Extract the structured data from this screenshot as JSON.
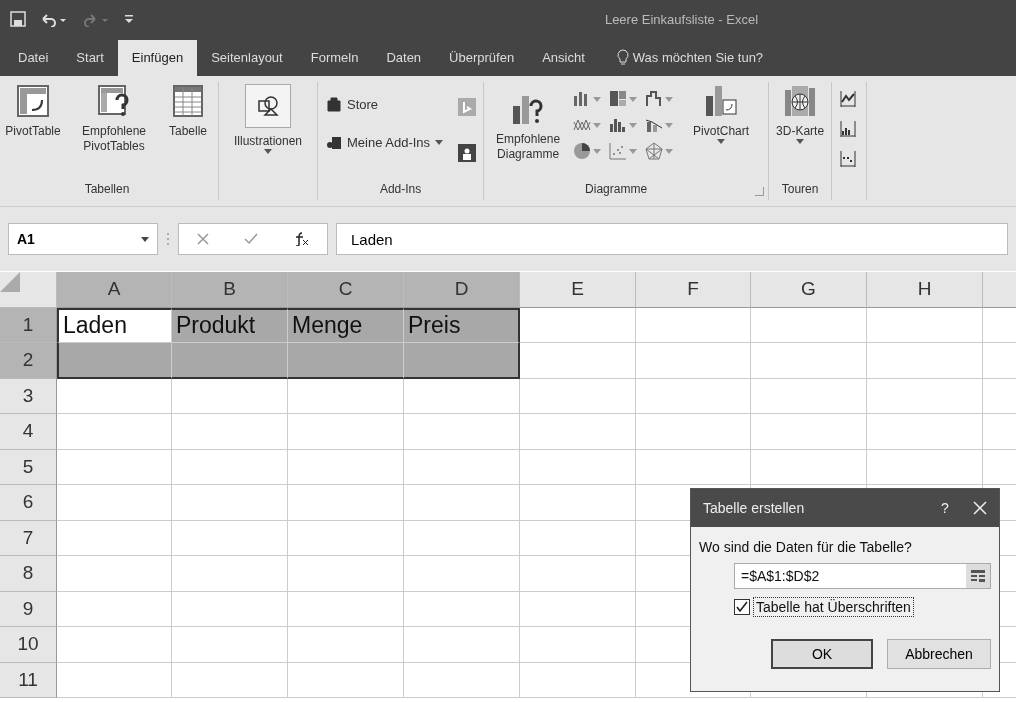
{
  "window": {
    "title": "Leere Einkaufsliste - Excel"
  },
  "tabs": [
    {
      "label": "Datei",
      "selected": false
    },
    {
      "label": "Start",
      "selected": false
    },
    {
      "label": "Einfügen",
      "selected": true
    },
    {
      "label": "Seitenlayout",
      "selected": false
    },
    {
      "label": "Formeln",
      "selected": false
    },
    {
      "label": "Daten",
      "selected": false
    },
    {
      "label": "Überprüfen",
      "selected": false
    },
    {
      "label": "Ansicht",
      "selected": false
    }
  ],
  "tell_me": {
    "placeholder": "Was möchten Sie tun?"
  },
  "ribbon": {
    "groups": [
      {
        "label": "Tabellen",
        "items": [
          {
            "kind": "pivot",
            "label": "PivotTable"
          },
          {
            "kind": "recpivot",
            "label": "Empfohlene PivotTables"
          },
          {
            "kind": "table",
            "label": "Tabelle"
          }
        ]
      },
      {
        "items": [
          {
            "kind": "shapes",
            "label": "Illustrationen",
            "dropdown": true
          }
        ]
      },
      {
        "label": "Add-Ins",
        "items": [
          {
            "kind": "addins"
          }
        ]
      },
      {
        "label": "Diagramme",
        "items": [
          {
            "kind": "recchart",
            "label": "Empfohlene Diagramme"
          },
          {
            "kind": "chartgrid"
          },
          {
            "kind": "pivotchart",
            "label": "PivotChart",
            "dropdown": true
          }
        ],
        "launcher": true
      },
      {
        "label": "Touren",
        "items": [
          {
            "kind": "map",
            "label": "3D-Karte",
            "dropdown": true
          }
        ]
      },
      {
        "items": [
          {
            "kind": "sparklines"
          }
        ]
      }
    ]
  },
  "addins": [
    {
      "label": "Store"
    },
    {
      "label": "Meine Add-Ins",
      "dropdown": true
    }
  ],
  "formula_bar": {
    "name_box": "A1",
    "formula": "Laden"
  },
  "sheet": {
    "columns": [
      {
        "label": "A",
        "selected": true
      },
      {
        "label": "B",
        "selected": true
      },
      {
        "label": "C",
        "selected": true
      },
      {
        "label": "D",
        "selected": true
      },
      {
        "label": "E",
        "selected": false
      },
      {
        "label": "F",
        "selected": false
      },
      {
        "label": "G",
        "selected": false
      },
      {
        "label": "H",
        "selected": false
      }
    ],
    "rows": [
      {
        "label": "1",
        "selected": true,
        "cells": [
          {
            "text": "Laden",
            "selected": true,
            "active": true
          },
          {
            "text": "Produkt",
            "selected": true,
            "active": false
          },
          {
            "text": "Menge",
            "selected": true,
            "active": false
          },
          {
            "text": "Preis",
            "selected": true,
            "active": false
          }
        ]
      },
      {
        "label": "2",
        "selected": true,
        "cells": [
          {
            "selected": true,
            "active": false
          },
          {
            "selected": true,
            "active": false
          },
          {
            "selected": true,
            "active": false
          },
          {
            "selected": true,
            "active": false
          }
        ]
      },
      {
        "label": "3",
        "selected": false
      },
      {
        "label": "4",
        "selected": false
      },
      {
        "label": "5",
        "selected": false
      },
      {
        "label": "6",
        "selected": false
      },
      {
        "label": "7",
        "selected": false
      },
      {
        "label": "8",
        "selected": false
      },
      {
        "label": "9",
        "selected": false
      },
      {
        "label": "10",
        "selected": false
      },
      {
        "label": "11",
        "selected": false
      }
    ]
  },
  "dialog": {
    "title": "Tabelle erstellen",
    "help": "?",
    "prompt": "Wo sind die Daten für die Tabelle?",
    "range": "=$A$1:$D$2",
    "checkbox": {
      "label": "Tabelle hat Überschriften",
      "checked": true
    },
    "buttons": [
      {
        "label": "OK",
        "default": true
      },
      {
        "label": "Abbrechen",
        "default": false
      }
    ]
  }
}
